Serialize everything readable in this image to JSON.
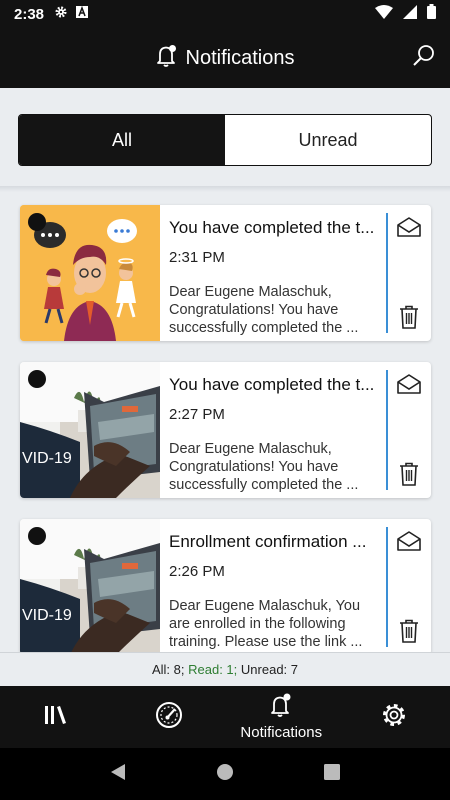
{
  "status": {
    "time": "2:38"
  },
  "header": {
    "title": "Notifications"
  },
  "tabs": [
    {
      "label": "All"
    },
    {
      "label": "Unread"
    }
  ],
  "notifications": [
    {
      "title": "You have completed the t...",
      "time": "2:31 PM",
      "body": "Dear Eugene Malaschuk, Congratulations! You have successfully completed the ...",
      "thumb": "cartoon-thinking-man"
    },
    {
      "title": "You have completed the t...",
      "time": "2:27 PM",
      "body": "Dear Eugene Malaschuk, Congratulations! You have successfully completed the ...",
      "thumb": "laptop-covid-photo",
      "thumb_text": "VID-19"
    },
    {
      "title": "Enrollment confirmation ...",
      "time": "2:26 PM",
      "body": "Dear Eugene Malaschuk, You are enrolled in the following training. Please use the link ...",
      "thumb": "laptop-covid-photo",
      "thumb_text": "VID-19"
    }
  ],
  "summary": {
    "all": "All: 8;",
    "read": "Read: 1;",
    "unread": "Unread: 7"
  },
  "bottom_nav": [
    {
      "icon": "library-icon"
    },
    {
      "icon": "dashboard-icon"
    },
    {
      "icon": "bell-icon",
      "label": "Notifications"
    },
    {
      "icon": "gear-icon"
    }
  ],
  "colors": {
    "accent_line": "#3a8fd6",
    "read_green": "#2e7d32",
    "thumb_yellow": "#f8b84a"
  }
}
